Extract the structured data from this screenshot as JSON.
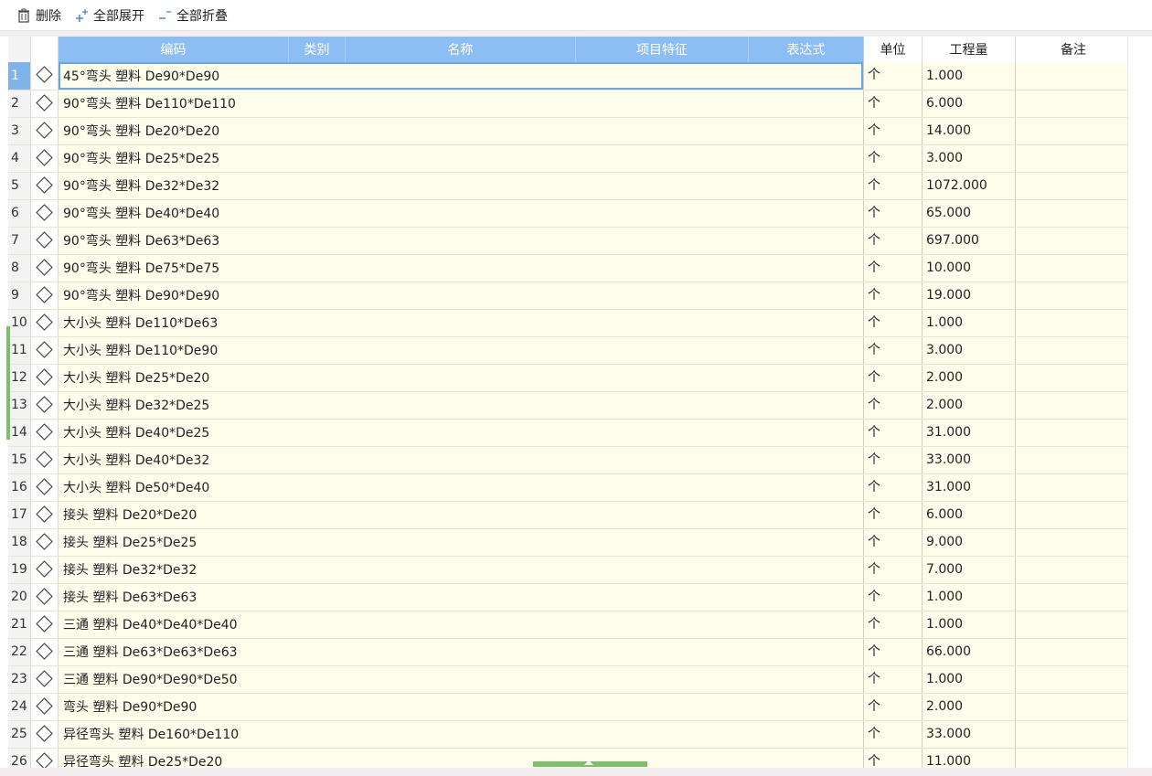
{
  "toolbar": {
    "delete_label": "删除",
    "expand_all_label": "全部展开",
    "collapse_all_label": "全部折叠"
  },
  "columns": {
    "code": "编码",
    "category": "类别",
    "name": "名称",
    "feature": "项目特征",
    "expression": "表达式",
    "unit": "单位",
    "quantity": "工程量",
    "remark": "备注"
  },
  "colors": {
    "header_blue": "#8cbef4",
    "cell_yellow": "#fefdeb",
    "selection": "#7fb3ea",
    "marker_green": "#7ac16a"
  },
  "rows": [
    {
      "n": "1",
      "name": "45°弯头 塑料 De90*De90",
      "unit": "个",
      "qty": "1.000"
    },
    {
      "n": "2",
      "name": "90°弯头 塑料 De110*De110",
      "unit": "个",
      "qty": "6.000"
    },
    {
      "n": "3",
      "name": "90°弯头 塑料 De20*De20",
      "unit": "个",
      "qty": "14.000"
    },
    {
      "n": "4",
      "name": "90°弯头 塑料 De25*De25",
      "unit": "个",
      "qty": "3.000"
    },
    {
      "n": "5",
      "name": "90°弯头 塑料 De32*De32",
      "unit": "个",
      "qty": "1072.000"
    },
    {
      "n": "6",
      "name": "90°弯头 塑料 De40*De40",
      "unit": "个",
      "qty": "65.000"
    },
    {
      "n": "7",
      "name": "90°弯头 塑料 De63*De63",
      "unit": "个",
      "qty": "697.000"
    },
    {
      "n": "8",
      "name": "90°弯头 塑料 De75*De75",
      "unit": "个",
      "qty": "10.000"
    },
    {
      "n": "9",
      "name": "90°弯头 塑料 De90*De90",
      "unit": "个",
      "qty": "19.000"
    },
    {
      "n": "10",
      "name": "大小头 塑料 De110*De63",
      "unit": "个",
      "qty": "1.000"
    },
    {
      "n": "11",
      "name": "大小头 塑料 De110*De90",
      "unit": "个",
      "qty": "3.000"
    },
    {
      "n": "12",
      "name": "大小头 塑料 De25*De20",
      "unit": "个",
      "qty": "2.000"
    },
    {
      "n": "13",
      "name": "大小头 塑料 De32*De25",
      "unit": "个",
      "qty": "2.000"
    },
    {
      "n": "14",
      "name": "大小头 塑料 De40*De25",
      "unit": "个",
      "qty": "31.000"
    },
    {
      "n": "15",
      "name": "大小头 塑料 De40*De32",
      "unit": "个",
      "qty": "33.000"
    },
    {
      "n": "16",
      "name": "大小头 塑料 De50*De40",
      "unit": "个",
      "qty": "31.000"
    },
    {
      "n": "17",
      "name": "接头 塑料 De20*De20",
      "unit": "个",
      "qty": "6.000"
    },
    {
      "n": "18",
      "name": "接头 塑料 De25*De25",
      "unit": "个",
      "qty": "9.000"
    },
    {
      "n": "19",
      "name": "接头 塑料 De32*De32",
      "unit": "个",
      "qty": "7.000"
    },
    {
      "n": "20",
      "name": "接头 塑料 De63*De63",
      "unit": "个",
      "qty": "1.000"
    },
    {
      "n": "21",
      "name": "三通 塑料 De40*De40*De40",
      "unit": "个",
      "qty": "1.000"
    },
    {
      "n": "22",
      "name": "三通 塑料 De63*De63*De63",
      "unit": "个",
      "qty": "66.000"
    },
    {
      "n": "23",
      "name": "三通 塑料 De90*De90*De50",
      "unit": "个",
      "qty": "1.000"
    },
    {
      "n": "24",
      "name": "弯头 塑料 De90*De90",
      "unit": "个",
      "qty": "2.000"
    },
    {
      "n": "25",
      "name": "异径弯头 塑料 De160*De110",
      "unit": "个",
      "qty": "33.000"
    },
    {
      "n": "26",
      "name": "异径弯头 塑料 De25*De20",
      "unit": "个",
      "qty": "11.000"
    }
  ]
}
